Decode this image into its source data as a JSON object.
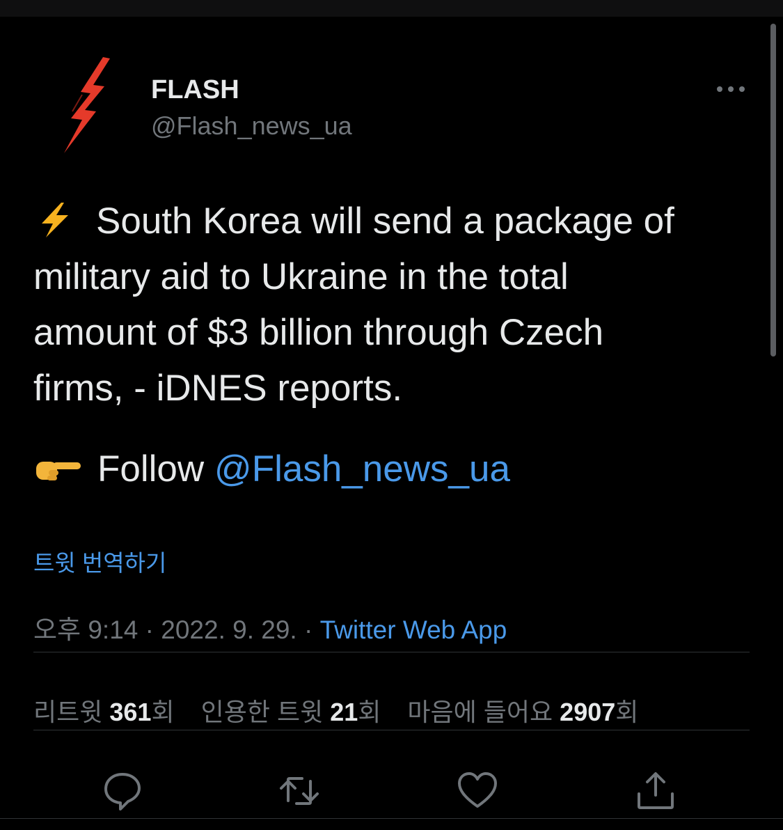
{
  "author": {
    "display_name": "FLASH",
    "handle": "@Flash_news_ua",
    "avatar_icon": "red-lightning-bolt-icon"
  },
  "tweet": {
    "lines": [
      "South Korea will send a package of",
      "military aid to Ukraine in the total",
      "amount of $3 billion through Czech",
      "firms, - iDNES reports."
    ],
    "lead_emoji": "high-voltage-emoji",
    "follow_prefix": "Follow",
    "follow_emoji": "pointing-right-hand-emoji",
    "mention": "@Flash_news_ua"
  },
  "translate_label": "트윗 번역하기",
  "meta": {
    "time": "오후 9:14",
    "sep1": " · ",
    "date": "2022. 9. 29.",
    "sep2": " · ",
    "source": "Twitter Web App"
  },
  "stats": {
    "retweets_label": "리트윗",
    "retweets_count": "361",
    "retweets_suffix": "회",
    "quotes_label": "인용한 트윗",
    "quotes_count": "21",
    "quotes_suffix": "회",
    "likes_label": "마음에 들어요",
    "likes_count": "2907",
    "likes_suffix": "회"
  },
  "actions": [
    "reply-icon",
    "retweet-icon",
    "like-icon",
    "share-icon"
  ],
  "colors": {
    "background": "#000000",
    "text": "#e7e9ea",
    "secondary": "#71767b",
    "link": "#4a99e9",
    "divider": "#2f3336"
  }
}
